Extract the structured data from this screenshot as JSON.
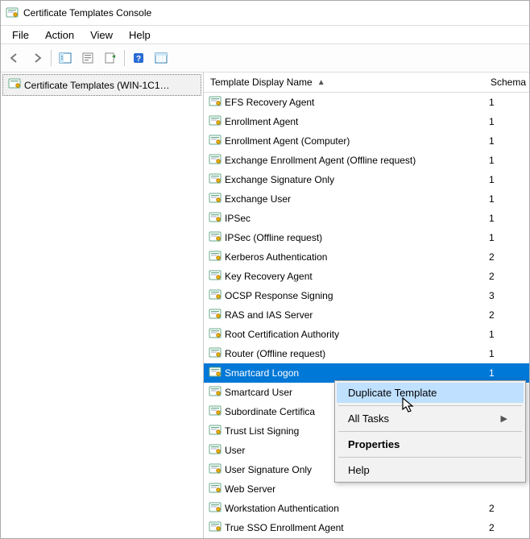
{
  "window": {
    "title": "Certificate Templates Console"
  },
  "menu": {
    "file": "File",
    "action": "Action",
    "view": "View",
    "help": "Help"
  },
  "tree": {
    "root": "Certificate Templates (WIN-1C1…"
  },
  "columns": {
    "name": "Template Display Name",
    "schema": "Schema"
  },
  "templates": [
    {
      "name": "EFS Recovery Agent",
      "schema": "1"
    },
    {
      "name": "Enrollment Agent",
      "schema": "1"
    },
    {
      "name": "Enrollment Agent (Computer)",
      "schema": "1"
    },
    {
      "name": "Exchange Enrollment Agent (Offline request)",
      "schema": "1"
    },
    {
      "name": "Exchange Signature Only",
      "schema": "1"
    },
    {
      "name": "Exchange User",
      "schema": "1"
    },
    {
      "name": "IPSec",
      "schema": "1"
    },
    {
      "name": "IPSec (Offline request)",
      "schema": "1"
    },
    {
      "name": "Kerberos Authentication",
      "schema": "2"
    },
    {
      "name": "Key Recovery Agent",
      "schema": "2"
    },
    {
      "name": "OCSP Response Signing",
      "schema": "3"
    },
    {
      "name": "RAS and IAS Server",
      "schema": "2"
    },
    {
      "name": "Root Certification Authority",
      "schema": "1"
    },
    {
      "name": "Router (Offline request)",
      "schema": "1"
    },
    {
      "name": "Smartcard Logon",
      "schema": "1",
      "selected": true
    },
    {
      "name": "Smartcard User",
      "schema": ""
    },
    {
      "name": "Subordinate Certifica",
      "schema": ""
    },
    {
      "name": "Trust List Signing",
      "schema": ""
    },
    {
      "name": "User",
      "schema": ""
    },
    {
      "name": "User Signature Only",
      "schema": ""
    },
    {
      "name": "Web Server",
      "schema": ""
    },
    {
      "name": "Workstation Authentication",
      "schema": "2"
    },
    {
      "name": "True SSO Enrollment Agent",
      "schema": "2"
    }
  ],
  "context_menu": {
    "duplicate": "Duplicate Template",
    "all_tasks": "All Tasks",
    "properties": "Properties",
    "help": "Help"
  }
}
